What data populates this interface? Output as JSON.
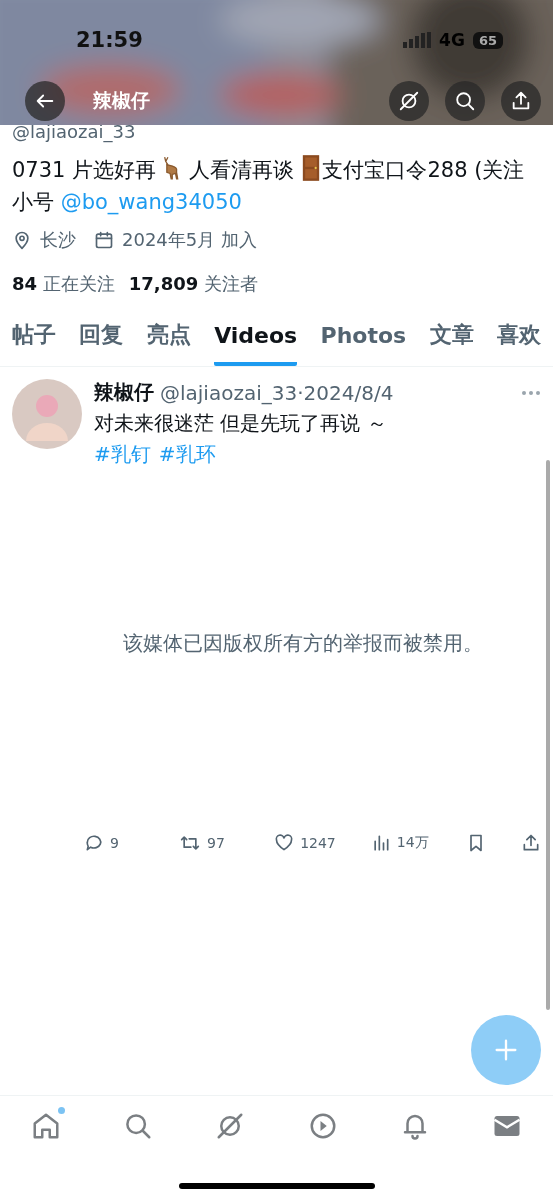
{
  "status_bar": {
    "time": "21:59",
    "network": "4G",
    "battery": "65"
  },
  "header": {
    "title": "辣椒仔"
  },
  "profile": {
    "handle": "@lajiaozai_33",
    "bio": [
      {
        "kind": "text",
        "text": "0731 片选好再"
      },
      {
        "kind": "emoji"
      },
      {
        "kind": "text",
        "text": " 人看清再谈 "
      },
      {
        "kind": "emoji"
      },
      {
        "kind": "text",
        "text": "支付宝口令288 (关注小号 "
      },
      {
        "kind": "link",
        "text": "@bo_wang34050"
      }
    ],
    "location": "长沙",
    "joined": "2024年5月 加入",
    "following_count": "84",
    "following_label": "正在关注",
    "followers_count": "17,809",
    "followers_label": "关注者"
  },
  "tabs": [
    {
      "label": "帖子",
      "selected": false
    },
    {
      "label": "回复",
      "selected": false
    },
    {
      "label": "亮点",
      "selected": false
    },
    {
      "label": "Videos",
      "selected": true
    },
    {
      "label": "Photos",
      "selected": false
    },
    {
      "label": "文章",
      "selected": false
    },
    {
      "label": "喜欢",
      "selected": false
    }
  ],
  "post": {
    "name": "辣椒仔",
    "handle": "@lajiaozai_33·2024/8/4",
    "text": "对未来很迷茫 但是先玩了再说 ～",
    "hashtags": [
      "#乳钉",
      "#乳环"
    ],
    "media_notice": "该媒体已因版权所有方的举报而被禁用。",
    "actions": [
      {
        "kind": "reply",
        "count": "9"
      },
      {
        "kind": "repost",
        "count": "97"
      },
      {
        "kind": "like",
        "count": "1247"
      },
      {
        "kind": "views",
        "count": "14万"
      },
      {
        "kind": "bookmark"
      },
      {
        "kind": "share"
      }
    ]
  },
  "bottom_nav": [
    {
      "kind": "home",
      "badge": true
    },
    {
      "kind": "search",
      "badge": false
    },
    {
      "kind": "grok",
      "badge": false
    },
    {
      "kind": "video",
      "badge": false
    },
    {
      "kind": "notifications",
      "badge": false
    },
    {
      "kind": "messages",
      "badge": false
    }
  ]
}
